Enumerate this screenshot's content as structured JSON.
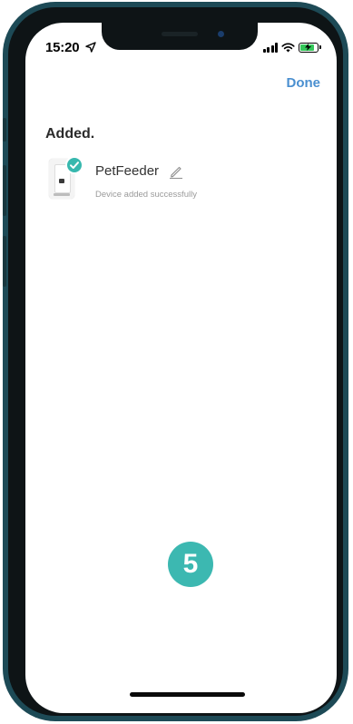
{
  "status_bar": {
    "time": "15:20"
  },
  "header": {
    "done_label": "Done"
  },
  "main": {
    "heading": "Added.",
    "device": {
      "name": "PetFeeder",
      "status": "Device added successfully"
    }
  },
  "overlay": {
    "step_number": "5"
  },
  "colors": {
    "accent_teal": "#37b8ae",
    "link_blue": "#4a8fd0",
    "frame": "#1d4a56"
  },
  "icons": [
    "location-arrow-icon",
    "signal-icon",
    "wifi-icon",
    "battery-charging-icon",
    "check-icon",
    "pencil-icon"
  ]
}
